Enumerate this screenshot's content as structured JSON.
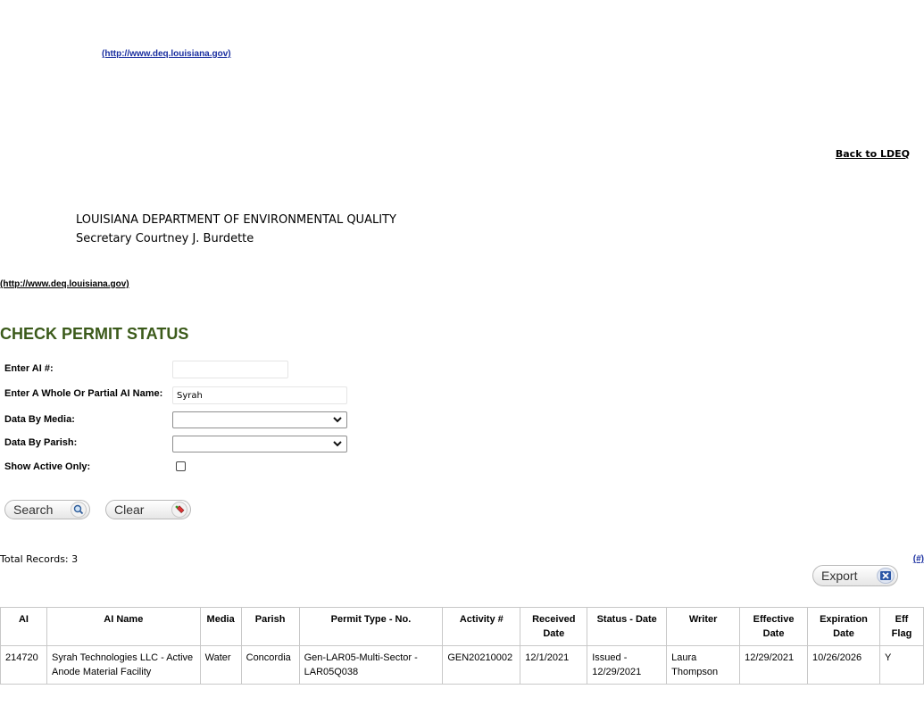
{
  "header": {
    "site_link": "(http://www.deq.louisiana.gov)",
    "back_link": "Back to LDEQ",
    "agency_name": "LOUISIANA DEPARTMENT OF ENVIRONMENTAL QUALITY",
    "secretary": "Secretary Courtney J. Burdette",
    "site_link_2": "(http://www.deq.louisiana.gov)"
  },
  "page_title": "CHECK PERMIT STATUS",
  "form": {
    "ai_number_label": "Enter AI #:",
    "ai_number_value": "",
    "ai_name_label": "Enter A Whole Or Partial AI Name:",
    "ai_name_value": "Syrah",
    "media_label": "Data By Media:",
    "media_selected": "",
    "parish_label": "Data By Parish:",
    "parish_selected": "",
    "active_label": "Show Active Only:",
    "active_checked": false
  },
  "buttons": {
    "search": "Search",
    "clear": "Clear",
    "export": "Export"
  },
  "results": {
    "total_records": "Total Records: 3",
    "hash_link": "(#)",
    "columns": [
      "AI",
      "AI Name",
      "Media",
      "Parish",
      "Permit Type - No.",
      "Activity #",
      "Received Date",
      "Status - Date",
      "Writer",
      "Effective Date",
      "Expiration Date",
      "Eff Flag"
    ],
    "rows": [
      [
        "214720",
        "Syrah Technologies LLC - Active Anode Material Facility",
        "Water",
        "Concordia",
        "Gen-LAR05-Multi-Sector - LAR05Q038",
        "GEN20210002",
        "12/1/2021",
        "Issued - 12/29/2021",
        "Laura Thompson",
        "12/29/2021",
        "10/26/2026",
        "Y"
      ]
    ]
  },
  "icons": {
    "search": "magnifier-icon",
    "clear": "eraser-icon",
    "export": "excel-icon"
  },
  "colors": {
    "title": "#3b5a1a",
    "link": "#1a2fa0"
  }
}
